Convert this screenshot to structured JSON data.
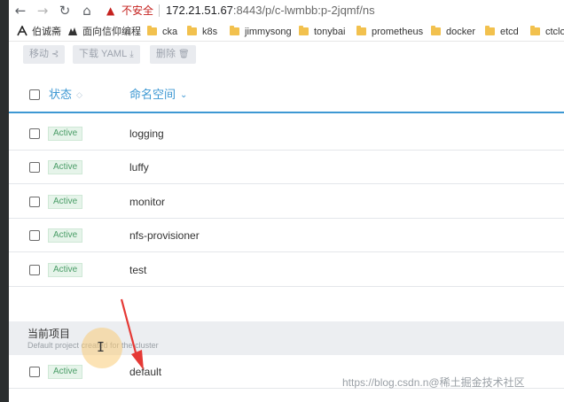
{
  "browser": {
    "nav": {
      "back": "←",
      "forward": "→",
      "reload": "↻",
      "home": "⌂"
    },
    "warning_icon": "▲",
    "security_label": "不安全",
    "url_host": "172.21.51.67",
    "url_path": ":8443/p/c-lwmbb:p-2jqmf/ns"
  },
  "bookmarks": [
    {
      "label": "伯诚斋",
      "icon": "bookmark-icon"
    },
    {
      "label": "面向信仰编程",
      "icon": "bookmark-icon"
    },
    {
      "label": "cka",
      "icon": "folder-icon"
    },
    {
      "label": "k8s",
      "icon": "folder-icon"
    },
    {
      "label": "jimmysong",
      "icon": "folder-icon"
    },
    {
      "label": "tonybai",
      "icon": "folder-icon"
    },
    {
      "label": "prometheus",
      "icon": "folder-icon"
    },
    {
      "label": "docker",
      "icon": "folder-icon"
    },
    {
      "label": "etcd",
      "icon": "folder-icon"
    },
    {
      "label": "ctclo",
      "icon": "folder-icon"
    }
  ],
  "toolbar": {
    "move_label": "移动",
    "move_icon": "⊰",
    "download_label": "下载 YAML",
    "download_icon": "⤓",
    "delete_label": "删除",
    "delete_icon": "🗑"
  },
  "table": {
    "col_state": "状态",
    "col_namespace": "命名空间",
    "state_sort_icon": "◇",
    "namespace_sort_icon": "⌄",
    "rows": [
      {
        "state": "Active",
        "name": "logging"
      },
      {
        "state": "Active",
        "name": "luffy"
      },
      {
        "state": "Active",
        "name": "monitor"
      },
      {
        "state": "Active",
        "name": "nfs-provisioner"
      },
      {
        "state": "Active",
        "name": "test"
      }
    ]
  },
  "group": {
    "title": "当前项目",
    "description": "Default project created for the cluster",
    "rows": [
      {
        "state": "Active",
        "name": "default"
      }
    ]
  },
  "overlay": {
    "cursor_glyph": "I",
    "watermark": "https://blog.csdn.n@稀土掘金技术社区"
  },
  "colors": {
    "accent": "#3d98d3",
    "active_badge_bg": "#e6f4ea",
    "active_badge_text": "#4a9d67",
    "arrow": "#e53935"
  }
}
